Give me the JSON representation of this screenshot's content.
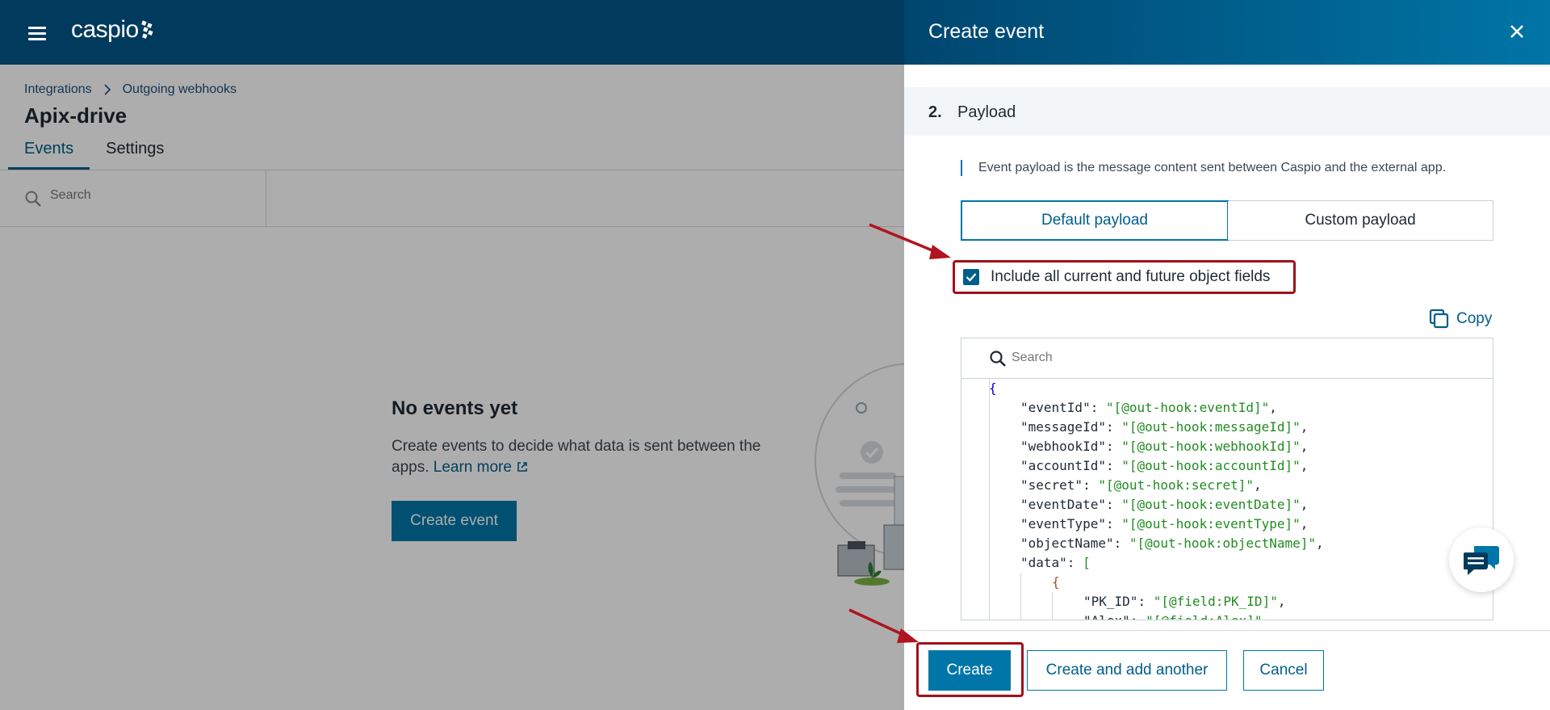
{
  "app": {
    "logo_text": "caspio",
    "accent_color": "#0076a8",
    "header_color": "#003a5d"
  },
  "breadcrumb": {
    "items": [
      "Integrations",
      "Outgoing webhooks"
    ]
  },
  "page": {
    "title": "Apix-drive",
    "tabs": [
      {
        "label": "Events",
        "active": true
      },
      {
        "label": "Settings",
        "active": false
      }
    ],
    "search_placeholder": "Search"
  },
  "empty_state": {
    "title": "No events yet",
    "description": "Create events to decide what data is sent between the apps.",
    "learn_more": "Learn more",
    "button": "Create event"
  },
  "drawer": {
    "title": "Create event",
    "section": {
      "number": "2.",
      "label": "Payload"
    },
    "note": "Event payload is the message content sent between Caspio and the external app.",
    "payload_options": [
      {
        "label": "Default payload",
        "active": true
      },
      {
        "label": "Custom payload",
        "active": false
      }
    ],
    "include_all_fields": {
      "label": "Include all current and future object fields",
      "checked": true
    },
    "copy_label": "Copy",
    "code_search_placeholder": "Search",
    "payload_lines": [
      {
        "key": "eventId",
        "value": "[@out-hook:eventId]"
      },
      {
        "key": "messageId",
        "value": "[@out-hook:messageId]"
      },
      {
        "key": "webhookId",
        "value": "[@out-hook:webhookId]"
      },
      {
        "key": "accountId",
        "value": "[@out-hook:accountId]"
      },
      {
        "key": "secret",
        "value": "[@out-hook:secret]"
      },
      {
        "key": "eventDate",
        "value": "[@out-hook:eventDate]"
      },
      {
        "key": "eventType",
        "value": "[@out-hook:eventType]"
      },
      {
        "key": "objectName",
        "value": "[@out-hook:objectName]"
      }
    ],
    "data_key": "data",
    "data_fields": [
      {
        "key": "PK_ID",
        "value": "[@field:PK_ID]"
      },
      {
        "key": "Alex",
        "value": "[@field:Alex]"
      }
    ],
    "buttons": {
      "create": "Create",
      "create_another": "Create and add another",
      "cancel": "Cancel"
    }
  }
}
